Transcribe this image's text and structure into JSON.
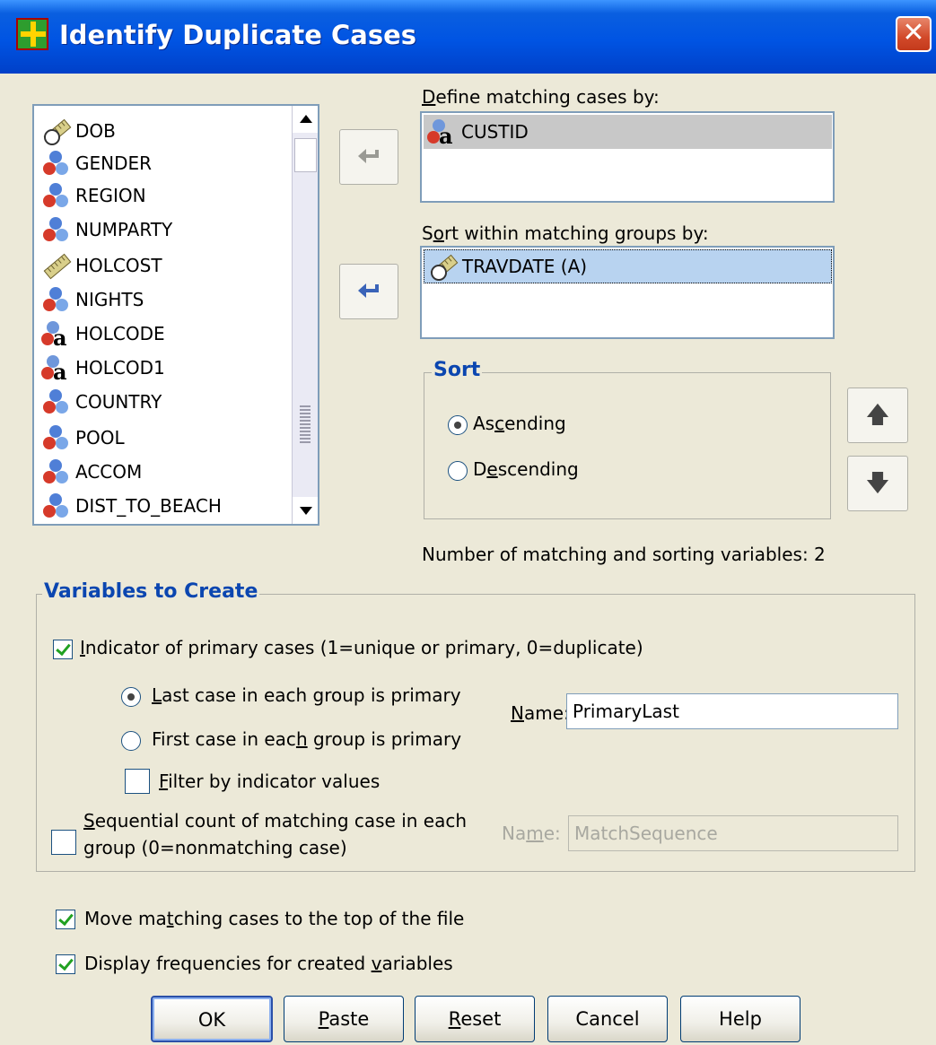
{
  "window": {
    "title": "Identify Duplicate Cases",
    "close_label": "✕"
  },
  "variable_list": {
    "items": [
      {
        "name": "DOB",
        "icon": "scale-date-icon"
      },
      {
        "name": "GENDER",
        "icon": "nominal-icon"
      },
      {
        "name": "REGION",
        "icon": "nominal-icon"
      },
      {
        "name": "NUMPARTY",
        "icon": "nominal-icon"
      },
      {
        "name": "HOLCOST",
        "icon": "scale-icon"
      },
      {
        "name": "NIGHTS",
        "icon": "nominal-icon"
      },
      {
        "name": "HOLCODE",
        "icon": "string-icon"
      },
      {
        "name": "HOLCOD1",
        "icon": "string-icon"
      },
      {
        "name": "COUNTRY",
        "icon": "nominal-icon"
      },
      {
        "name": "POOL",
        "icon": "nominal-icon"
      },
      {
        "name": "ACCOM",
        "icon": "nominal-icon"
      },
      {
        "name": "DIST_TO_BEACH",
        "icon": "nominal-icon"
      }
    ]
  },
  "matching": {
    "label_prefix": "D",
    "label_rest": "efine matching cases by:",
    "items": [
      {
        "name": "CUSTID",
        "icon": "string-icon"
      }
    ]
  },
  "sorting": {
    "label_prefix": "S",
    "label_u": "o",
    "label_rest": "rt within matching groups by:",
    "items": [
      {
        "name": "TRAVDATE (A)",
        "icon": "scale-date-icon"
      }
    ]
  },
  "sort_group": {
    "title": "Sort",
    "ascending": {
      "pre": "As",
      "u": "c",
      "post": "ending",
      "selected": true
    },
    "descending": {
      "pre": "D",
      "u": "e",
      "post": "scending",
      "selected": false
    }
  },
  "count_text": "Number of matching and sorting variables:  2",
  "variables_to_create": {
    "title": "Variables to Create",
    "indicator": {
      "u": "I",
      "rest": "ndicator of primary cases (1=unique or primary, 0=duplicate)",
      "checked": true
    },
    "last_case": {
      "u": "L",
      "rest": "ast case in each group is primary",
      "selected": true
    },
    "first_case": {
      "pre": "First case in eac",
      "u": "h",
      "post": " group is primary",
      "selected": false
    },
    "filter": {
      "u": "F",
      "rest": "ilter by indicator values",
      "checked": false
    },
    "name_label": {
      "u": "N",
      "rest": "ame:"
    },
    "name_value": "PrimaryLast",
    "sequential": {
      "u": "S",
      "line1_rest": "equential count of matching case in each",
      "line2": "group (0=nonmatching case)",
      "checked": false
    },
    "seq_name_label": {
      "pre": "Na",
      "u": "m",
      "post": "e:"
    },
    "seq_name_value": "MatchSequence"
  },
  "options": {
    "move_top": {
      "pre": "Move ma",
      "u": "t",
      "post": "ching cases to the top of the file",
      "checked": true
    },
    "display_freq": {
      "pre": "Display frequencies for created ",
      "u": "v",
      "post": "ariables",
      "checked": true
    }
  },
  "buttons": {
    "ok": "OK",
    "paste_u": "P",
    "paste_rest": "aste",
    "reset_u": "R",
    "reset_rest": "eset",
    "cancel": "Cancel",
    "help": "Help"
  },
  "move_up_glyph": "🡅",
  "move_down_glyph": "🡇"
}
